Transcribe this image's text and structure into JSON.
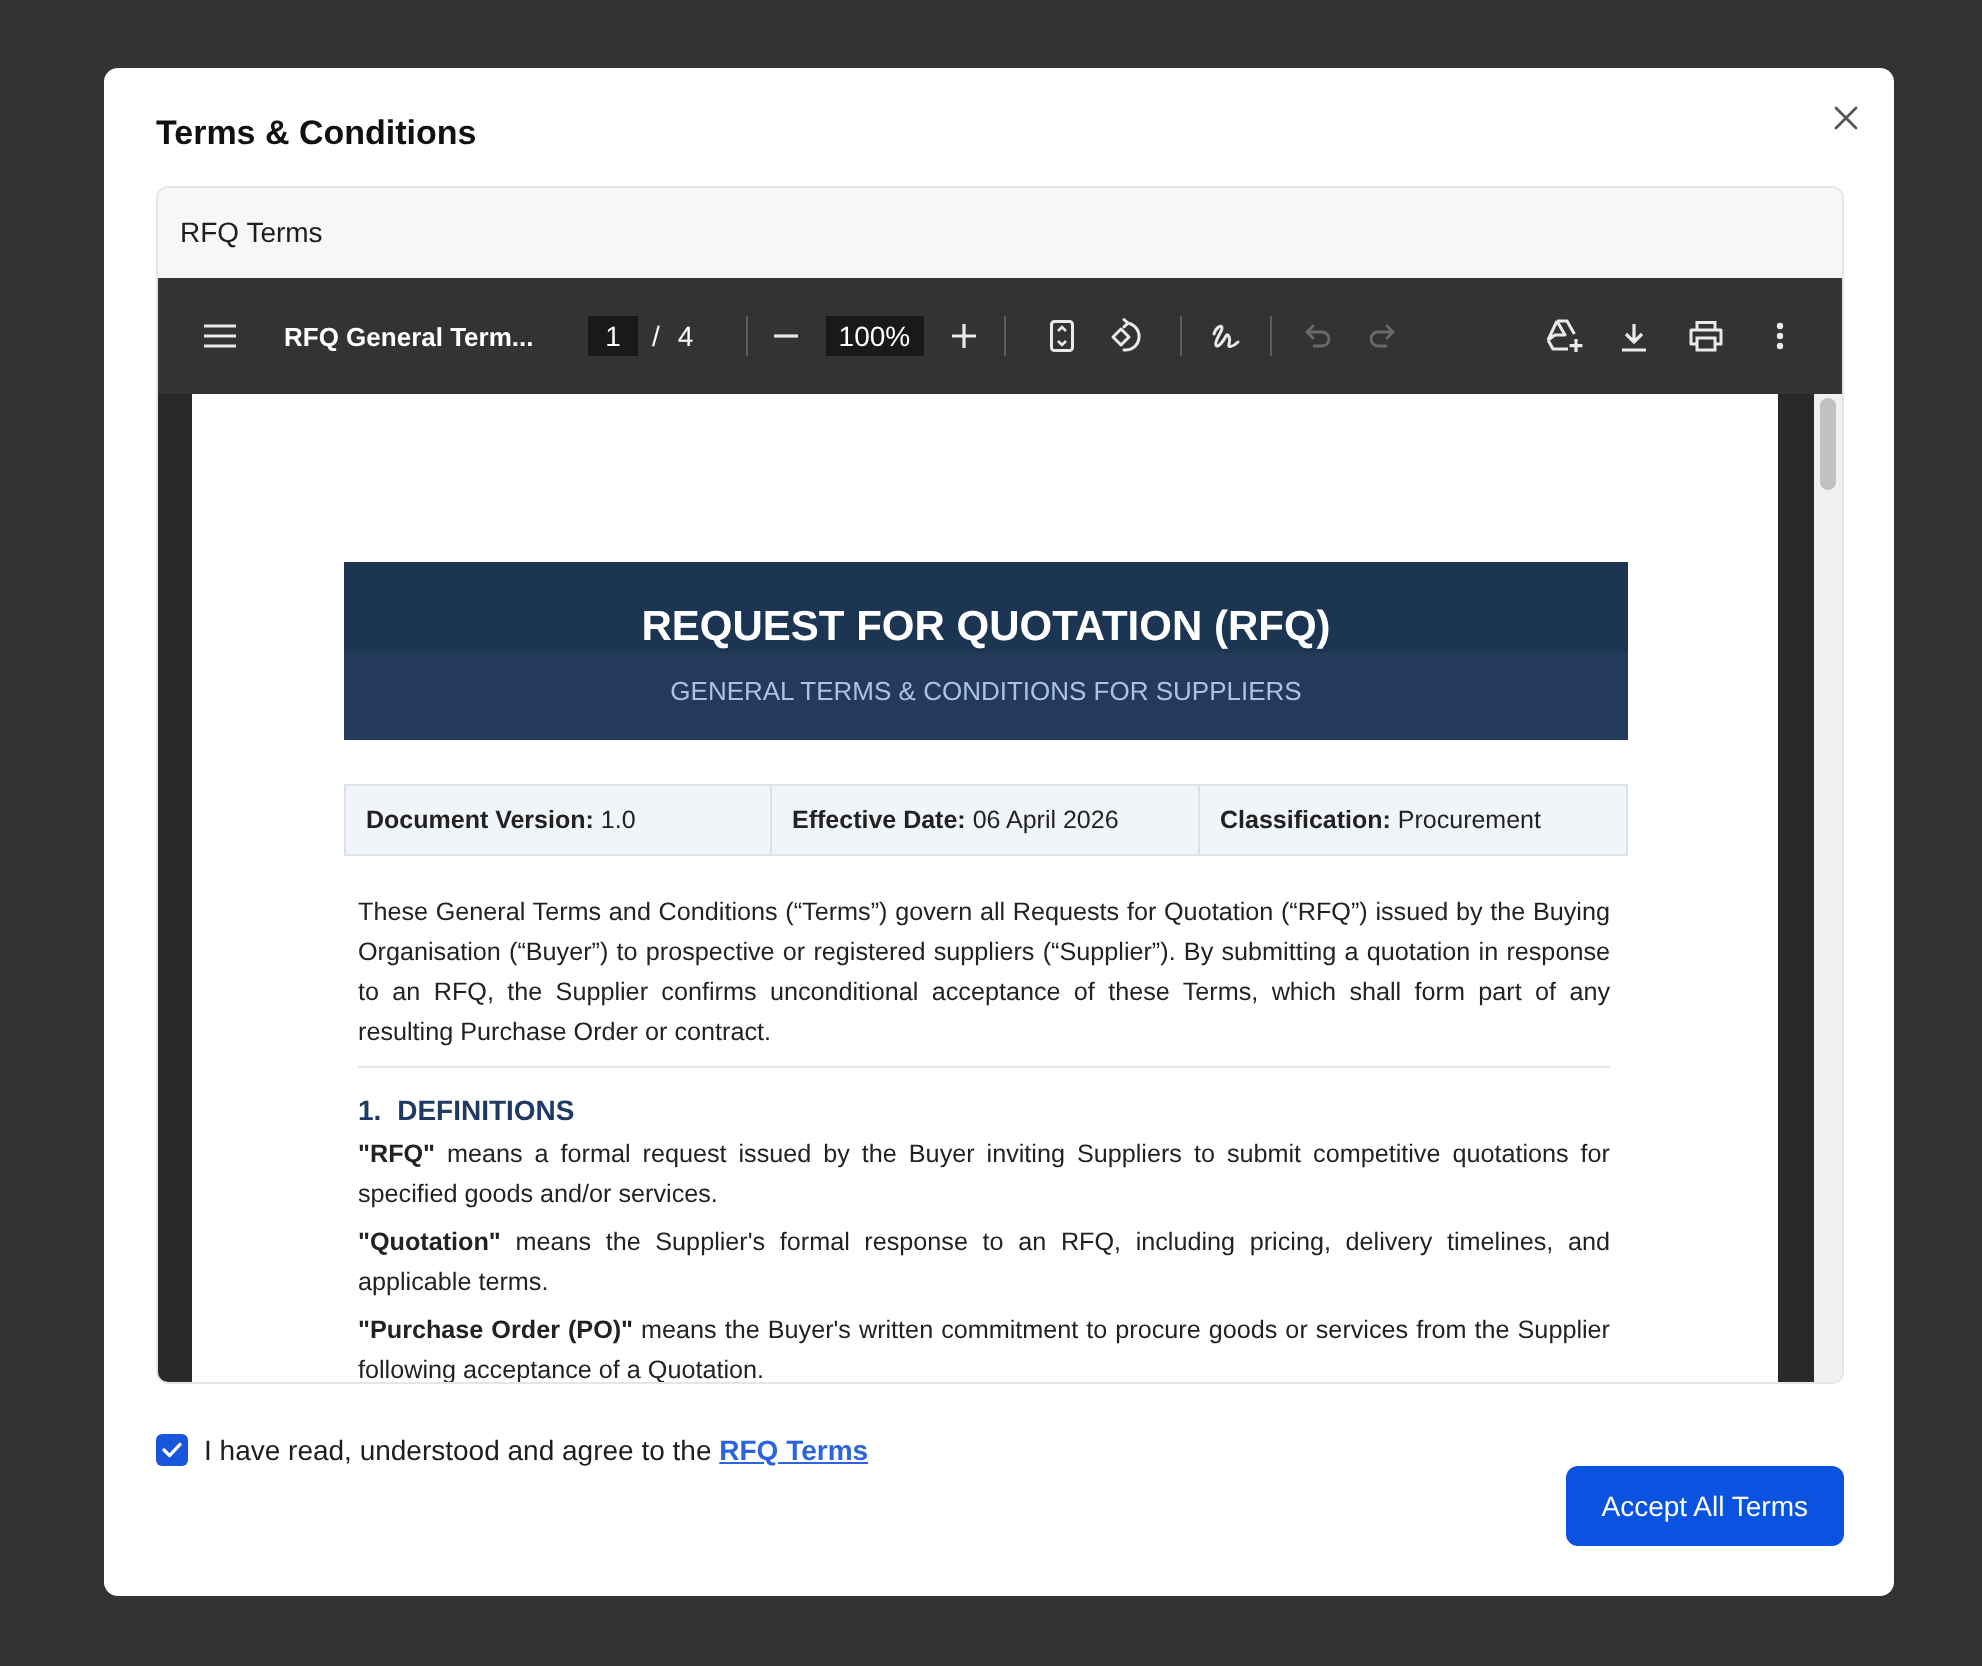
{
  "dialog": {
    "title": "Terms & Conditions"
  },
  "document_panel": {
    "header": "RFQ Terms"
  },
  "viewer": {
    "file_name": "RFQ General Term...",
    "page": "1",
    "page_separator": "/",
    "page_count": "4",
    "zoom": "100%",
    "undo": {
      "disabled": true
    },
    "redo": {
      "disabled": true
    }
  },
  "document": {
    "title": "REQUEST FOR QUOTATION (RFQ)",
    "subtitle": "GENERAL TERMS & CONDITIONS FOR SUPPLIERS",
    "meta": [
      "**Document Version:** 1.0",
      "**Effective Date:** 06 April 2026",
      "**Classification:** Procurement"
    ],
    "intro": "These General Terms and Conditions (“Terms”) govern all Requests for Quotation (“RFQ”) issued by the Buying Organisation (“Buyer”) to prospective or registered suppliers (“Supplier”). By submitting a quotation in response to an RFQ, the Supplier confirms unconditional acceptance of these Terms, which shall form part of any resulting Purchase Order or contract.",
    "sections": [
      {
        "number": "1.",
        "heading": "DEFINITIONS",
        "paragraphs": [
          "**\"RFQ\"** means a formal request issued by the Buyer inviting Suppliers to submit competitive quotations for specified goods and/or services.",
          "**\"Quotation\"** means the Supplier's formal response to an RFQ, including pricing, delivery timelines, and applicable terms.",
          "**\"Purchase Order (PO)\"** means the Buyer's written commitment to procure goods or services from the Supplier following acceptance of a Quotation."
        ]
      }
    ]
  },
  "consent": {
    "checked": true,
    "text": "I have read, understood and agree to the",
    "link": "RFQ Terms"
  },
  "buttons": [
    "Accept All Terms"
  ]
}
